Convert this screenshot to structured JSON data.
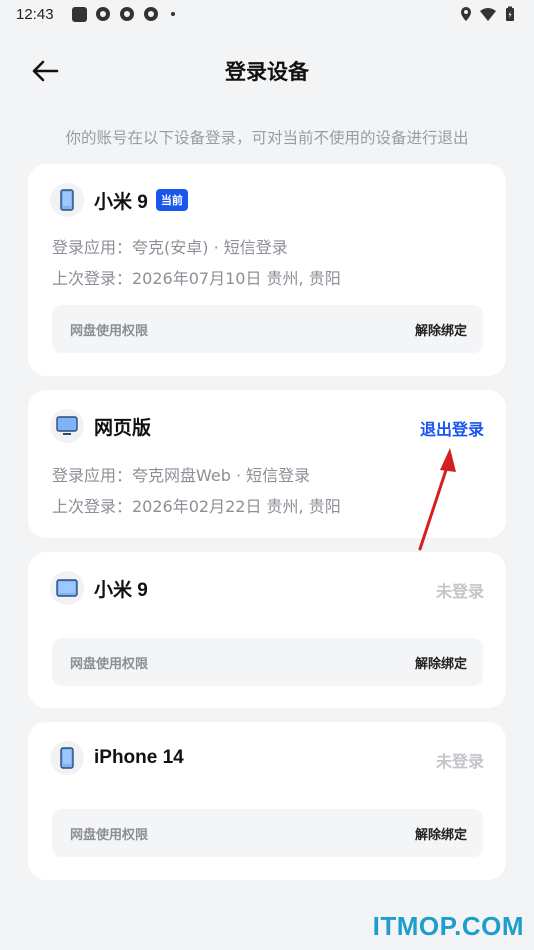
{
  "status_bar": {
    "time": "12:43"
  },
  "header": {
    "title": "登录设备"
  },
  "subtitle": "你的账号在以下设备登录，可对当前不使用的设备进行退出",
  "devices": [
    {
      "name": "小米 9",
      "badge": "当前",
      "icon": "phone-icon",
      "app_line": "登录应用：夸克(安卓) · 短信登录",
      "last_line": "上次登录：2026年07月10日    贵州, 贵阳",
      "permission_label": "网盘使用权限",
      "unbind_label": "解除绑定"
    },
    {
      "name": "网页版",
      "icon": "monitor-icon",
      "action": "退出登录",
      "app_line": "登录应用：夸克网盘Web · 短信登录",
      "last_line": "上次登录：2026年02月22日    贵州, 贵阳"
    },
    {
      "name": "小米 9",
      "icon": "tablet-icon",
      "action": "未登录",
      "permission_label": "网盘使用权限",
      "unbind_label": "解除绑定"
    },
    {
      "name": "iPhone 14",
      "icon": "phone-icon",
      "action": "未登录",
      "permission_label": "网盘使用权限",
      "unbind_label": "解除绑定"
    }
  ],
  "watermark": "ITMOP.COM",
  "colors": {
    "accent": "#1a55ee",
    "muted": "#c3c5ca",
    "annotation_arrow": "#d42020"
  }
}
